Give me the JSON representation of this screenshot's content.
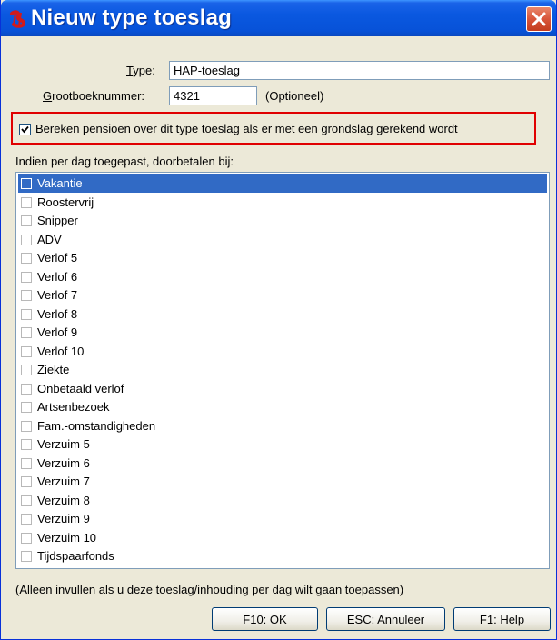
{
  "window": {
    "title": "Nieuw type toeslag"
  },
  "form": {
    "type_label": "Type:",
    "type_value": "HAP-toeslag",
    "ledger_label": "Grootboeknummer:",
    "ledger_value": "4321",
    "ledger_hint": "(Optioneel)",
    "pension_checkbox_label": "Bereken pensioen over dit type toeslag als er met een grondslag gerekend wordt",
    "pension_checked": true,
    "list_header": "Indien per dag toegepast, doorbetalen bij:",
    "footnote": "(Alleen invullen als u deze toeslag/inhouding per dag wilt gaan toepassen)"
  },
  "list": {
    "selected_index": 0,
    "items": [
      "Vakantie",
      "Roostervrij",
      "Snipper",
      "ADV",
      "Verlof 5",
      "Verlof 6",
      "Verlof 7",
      "Verlof 8",
      "Verlof 9",
      "Verlof 10",
      "Ziekte",
      "Onbetaald verlof",
      "Artsenbezoek",
      "Fam.-omstandigheden",
      "Verzuim 5",
      "Verzuim 6",
      "Verzuim 7",
      "Verzuim 8",
      "Verzuim 9",
      "Verzuim 10",
      "Tijdspaarfonds"
    ]
  },
  "buttons": {
    "ok": "F10: OK",
    "cancel": "ESC: Annuleer",
    "help": "F1: Help"
  },
  "colors": {
    "titlebar": "#0a58e0",
    "selection": "#316ac5",
    "highlight_border": "#e00000",
    "close": "#d8553a"
  }
}
